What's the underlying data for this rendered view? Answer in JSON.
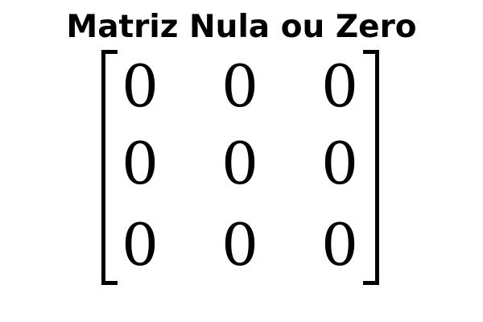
{
  "title": "Matriz Nula ou Zero",
  "matrix": {
    "rows": [
      [
        "0",
        "0",
        "0"
      ],
      [
        "0",
        "0",
        "0"
      ],
      [
        "0",
        "0",
        "0"
      ]
    ]
  },
  "colors": {
    "text": "#000000",
    "background": "#ffffff"
  }
}
